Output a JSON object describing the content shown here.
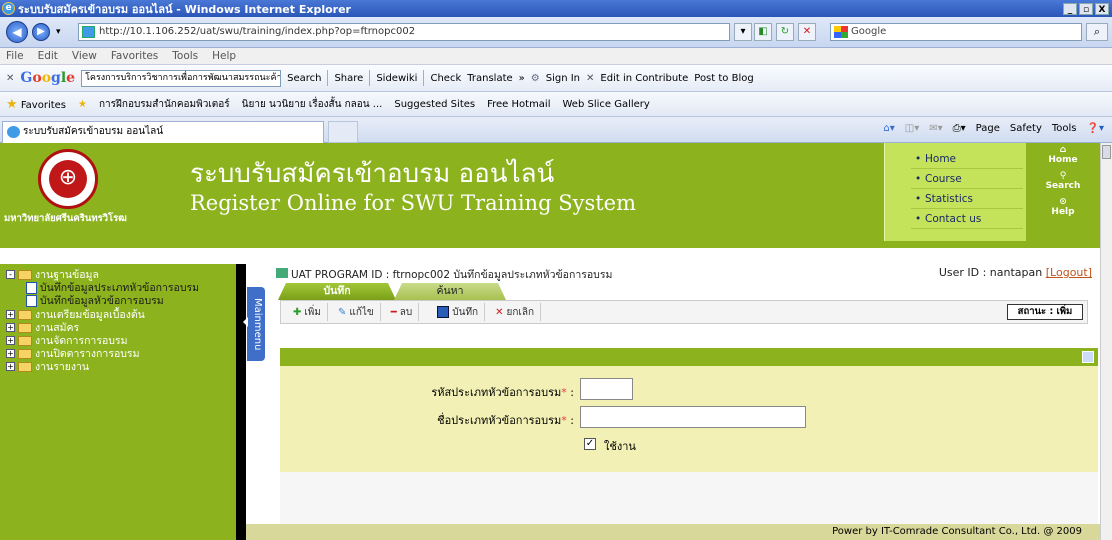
{
  "window": {
    "title": "ระบบรับสมัครเข้าอบรม ออนไลน์ - Windows Internet Explorer",
    "controls": [
      "_",
      "▫",
      "X"
    ]
  },
  "address": {
    "url": "http://10.1.106.252/uat/swu/training/index.php?op=ftrnopc002"
  },
  "search": {
    "placeholder": "Google"
  },
  "menu": [
    "File",
    "Edit",
    "View",
    "Favorites",
    "Tools",
    "Help"
  ],
  "google_toolbar": {
    "logo": "Google",
    "box": "โครงการบริการวิชาการเพื่อการพัฒนาสมรรถนะค้าา",
    "items": [
      "Search",
      "Share",
      "Sidewiki",
      "Check",
      "Translate",
      "»",
      "Sign In",
      "Edit in Contribute",
      "Post to Blog"
    ]
  },
  "favorites": {
    "label": "Favorites",
    "items": [
      "การฝึกอบรมสำนักคอมพิวเตอร์",
      "นิยาย นวนิยาย เรื่องสั้น กลอน ...",
      "Suggested Sites",
      "Free Hotmail",
      "Web Slice Gallery"
    ]
  },
  "tab": {
    "label": "ระบบรับสมัครเข้าอบรม ออนไลน์"
  },
  "command_bar": [
    "Page",
    "Safety",
    "Tools"
  ],
  "header": {
    "uni_name": "มหาวิทยาลัยศรีนครินทรวิโรฒ",
    "title_th": "ระบบรับสมัครเข้าอบรม ออนไลน์",
    "title_en": "Register Online for SWU Training System",
    "menu": [
      "Home",
      "Course",
      "Statistics",
      "Contact us"
    ],
    "side": [
      "Home",
      "Search",
      "Help"
    ]
  },
  "tree": [
    {
      "label": "งานฐานข้อมูล",
      "type": "folder",
      "expanded": true
    },
    {
      "label": "บันทึกข้อมูลประเภทหัวข้อการอบรม",
      "type": "doc"
    },
    {
      "label": "บันทึกข้อมูลหัวข้อการอบรม",
      "type": "doc"
    },
    {
      "label": "งานเตรียมข้อมูลเบื้องต้น",
      "type": "folder"
    },
    {
      "label": "งานสมัคร",
      "type": "folder"
    },
    {
      "label": "งานจัดการการอบรม",
      "type": "folder"
    },
    {
      "label": "งานปิดตารางการอบรม",
      "type": "folder"
    },
    {
      "label": "งานรายงาน",
      "type": "folder"
    }
  ],
  "mainmenu_label": "Mainmenu",
  "program": {
    "line": "UAT   PROGRAM ID : ftrnopc002 บันทึกข้อมูลประเภทหัวข้อการอบรม",
    "user_label": "User ID : nantapan",
    "logout": "[Logout]"
  },
  "form_tabs": [
    "บันทึก",
    "ค้นหา"
  ],
  "toolbar": {
    "add": "เพิ่ม",
    "edit": "แก้ไข",
    "delete": "ลบ",
    "save": "บันทึก",
    "cancel": "ยกเลิก",
    "status": "สถานะ : เพิ่ม"
  },
  "form": {
    "code_label": "รหัสประเภทหัวข้อการอบรม",
    "name_label": "ชื่อประเภทหัวข้อการอบรม",
    "required_mark": "*",
    "sep": " :",
    "active_label": "ใช้งาน",
    "active_checked": true
  },
  "footer": "Power by IT-Comrade Consultant Co., Ltd. @ 2009"
}
